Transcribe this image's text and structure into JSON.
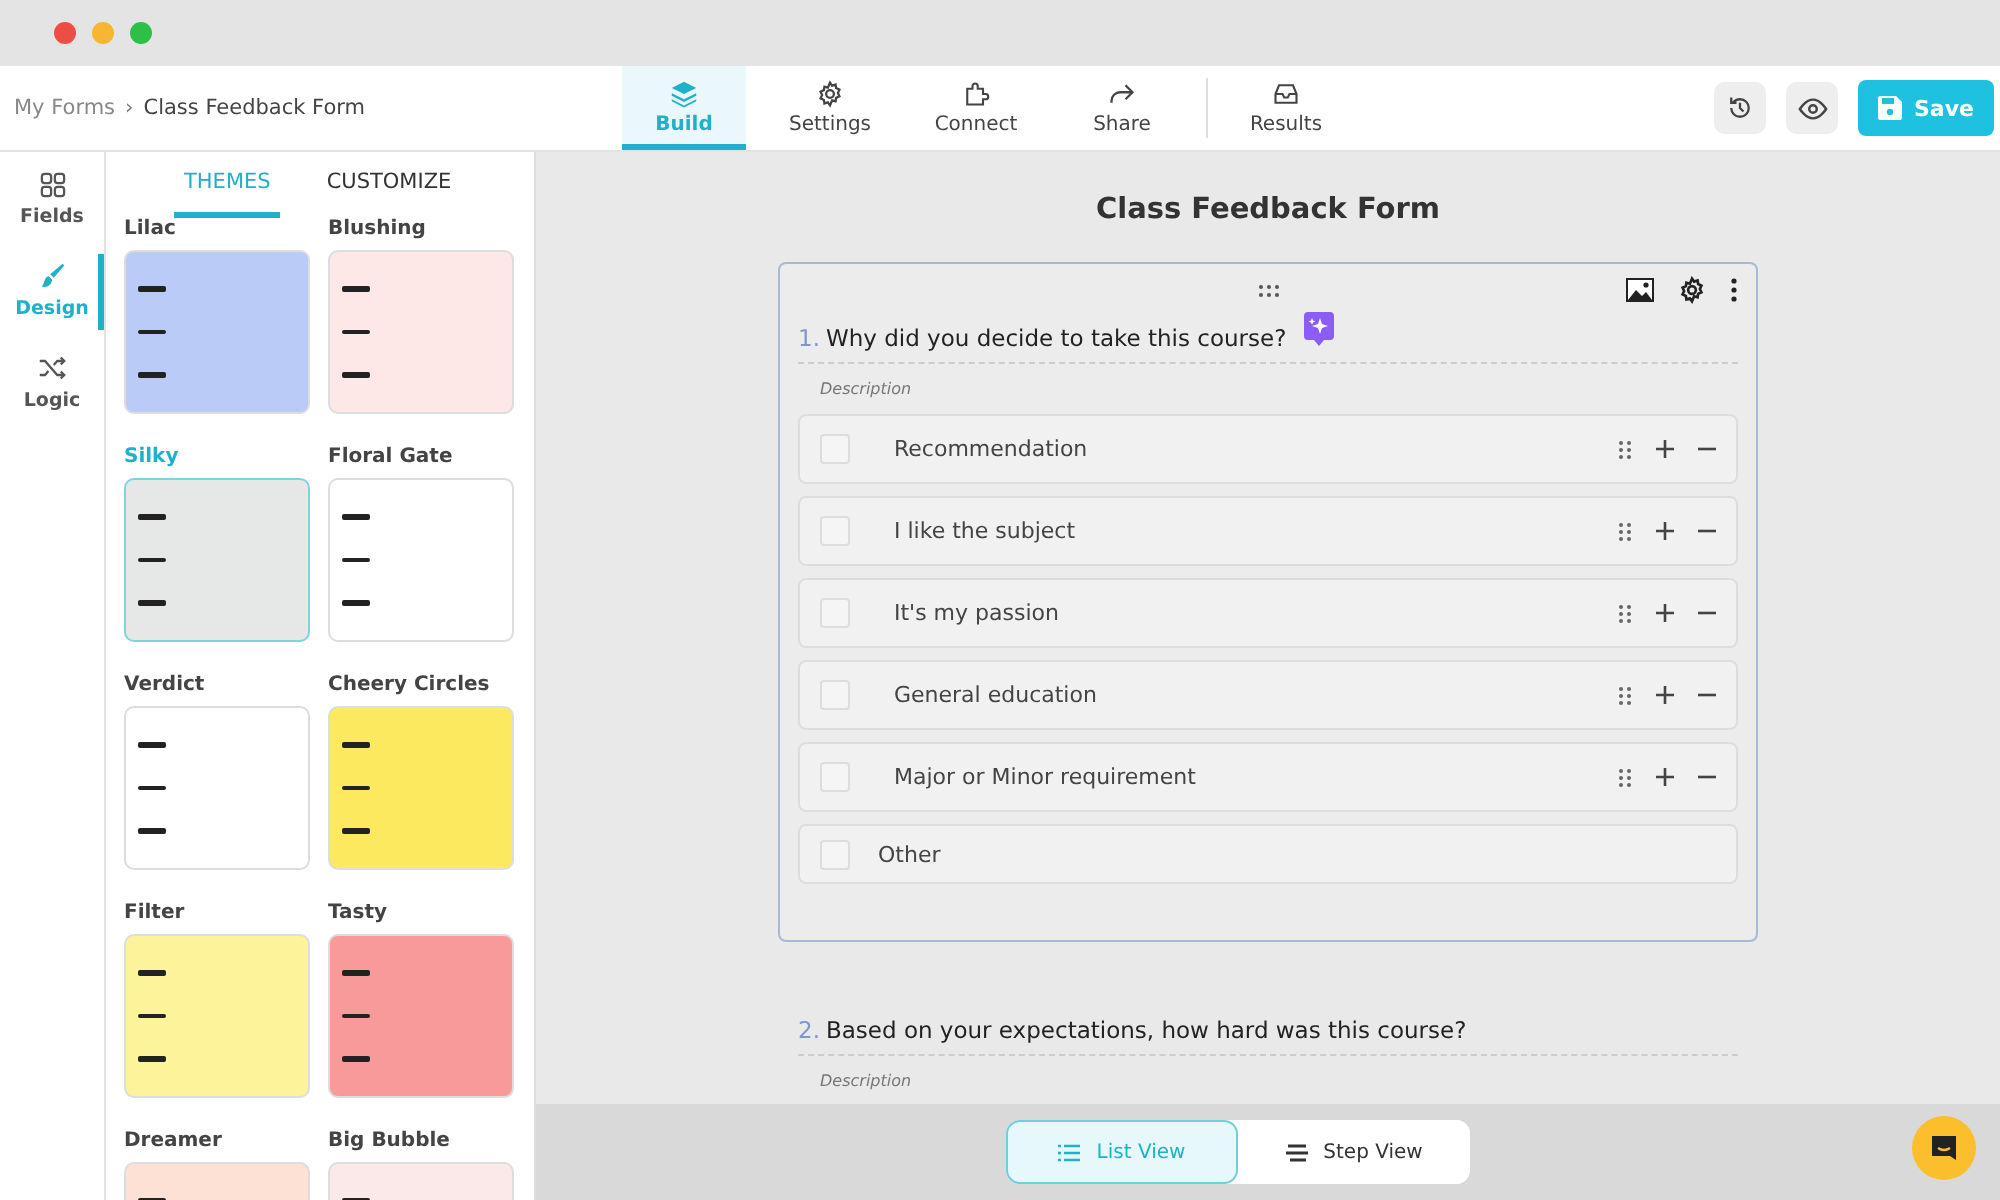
{
  "breadcrumb": {
    "parent": "My Forms",
    "separator": "›",
    "current": "Class Feedback Form"
  },
  "nav_tabs": [
    {
      "label": "Build",
      "selected": true
    },
    {
      "label": "Settings",
      "selected": false
    },
    {
      "label": "Connect",
      "selected": false
    },
    {
      "label": "Share",
      "selected": false
    },
    {
      "label": "Results",
      "selected": false
    }
  ],
  "save_button": "Save",
  "rail": [
    {
      "label": "Fields",
      "selected": false
    },
    {
      "label": "Design",
      "selected": true
    },
    {
      "label": "Logic",
      "selected": false
    }
  ],
  "panel_tabs": [
    {
      "label": "THEMES",
      "selected": true
    },
    {
      "label": "CUSTOMIZE",
      "selected": false
    }
  ],
  "themes": [
    {
      "name": "Lilac",
      "selected": false,
      "color": "#b9cbf6"
    },
    {
      "name": "Blushing",
      "selected": false,
      "color": "#fde7e7"
    },
    {
      "name": "Silky",
      "selected": true,
      "color": "#e6e7e7"
    },
    {
      "name": "Floral Gate",
      "selected": false,
      "color": "#ffffff"
    },
    {
      "name": "Verdict",
      "selected": false,
      "color": "#ffffff"
    },
    {
      "name": "Cheery Circles",
      "selected": false,
      "color": "#fde95f"
    },
    {
      "name": "Filter",
      "selected": false,
      "color": "#fdf39b"
    },
    {
      "name": "Tasty",
      "selected": false,
      "color": "#f89a9a"
    },
    {
      "name": "Dreamer",
      "selected": false,
      "color": "#fde1d4"
    },
    {
      "name": "Big Bubble",
      "selected": false,
      "color": "#fbe9ea"
    }
  ],
  "form_title": "Class Feedback Form",
  "questions": [
    {
      "number": "1.",
      "title": "Why did you decide to take this course?",
      "description": "Description",
      "selected": true,
      "options": [
        {
          "label": "Recommendation",
          "kind": "choice",
          "checked": false
        },
        {
          "label": "I like the subject",
          "kind": "choice",
          "checked": false
        },
        {
          "label": "It's my passion",
          "kind": "choice",
          "checked": false
        },
        {
          "label": "General education",
          "kind": "choice",
          "checked": false
        },
        {
          "label": "Major or Minor requirement",
          "kind": "choice",
          "checked": false
        },
        {
          "label": "Other",
          "kind": "other",
          "checked": false
        }
      ]
    },
    {
      "number": "2.",
      "title": "Based on your expectations, how hard was this course?",
      "description": "Description",
      "selected": false
    }
  ],
  "view_toggle": [
    {
      "label": "List View",
      "selected": true
    },
    {
      "label": "Step View",
      "selected": false
    }
  ]
}
